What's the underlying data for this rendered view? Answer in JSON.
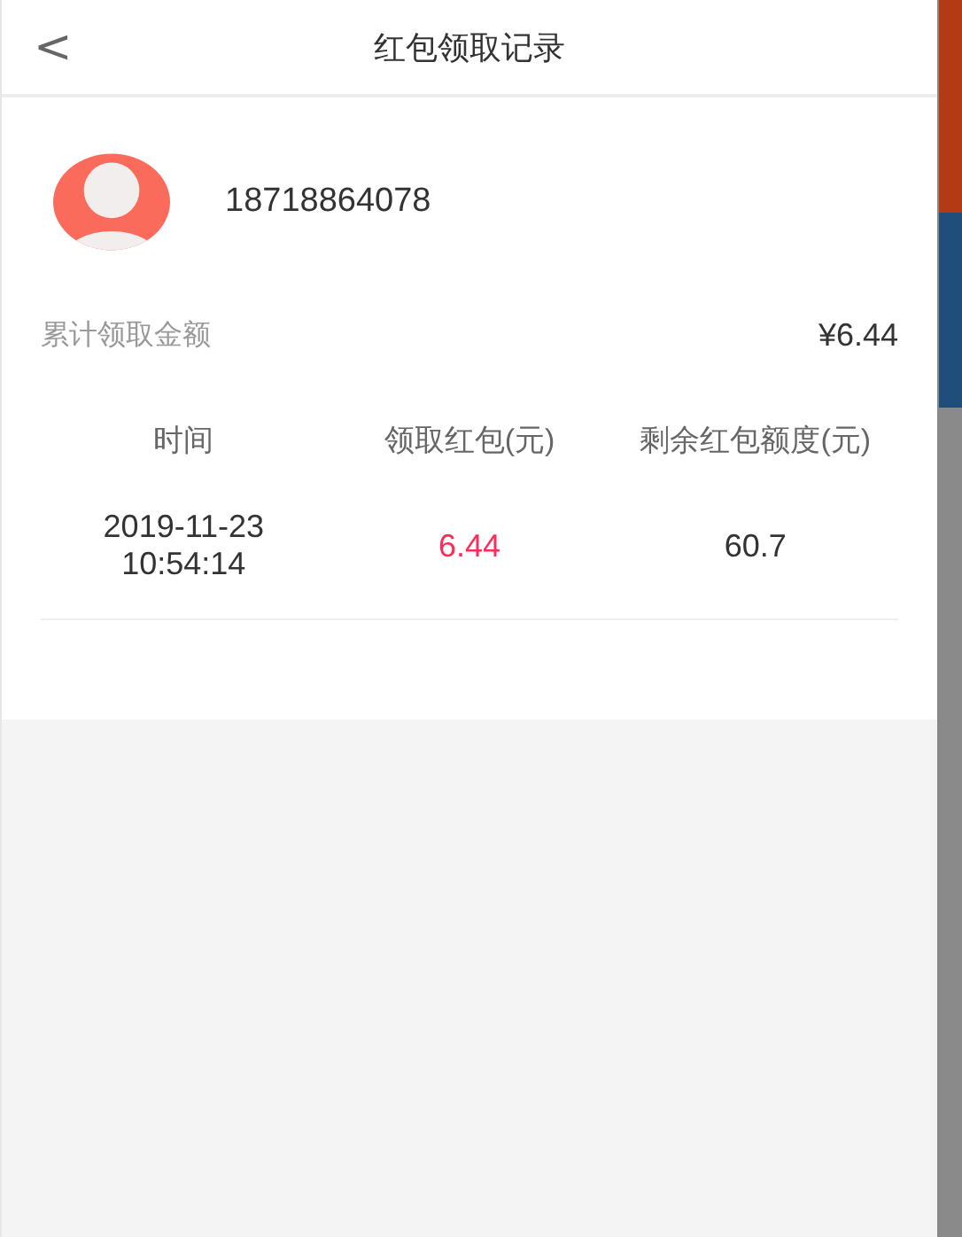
{
  "header": {
    "back_icon": "<",
    "title": "红包领取记录"
  },
  "profile": {
    "phone": "18718864078"
  },
  "summary": {
    "label": "累计领取金额",
    "amount": "¥6.44"
  },
  "table": {
    "columns": [
      "时间",
      "领取红包(元)",
      "剩余红包额度(元)"
    ],
    "rows": [
      {
        "time": [
          "2019-11-23",
          "10:54:14"
        ],
        "received": "6.44",
        "remaining": "60.7"
      }
    ]
  }
}
